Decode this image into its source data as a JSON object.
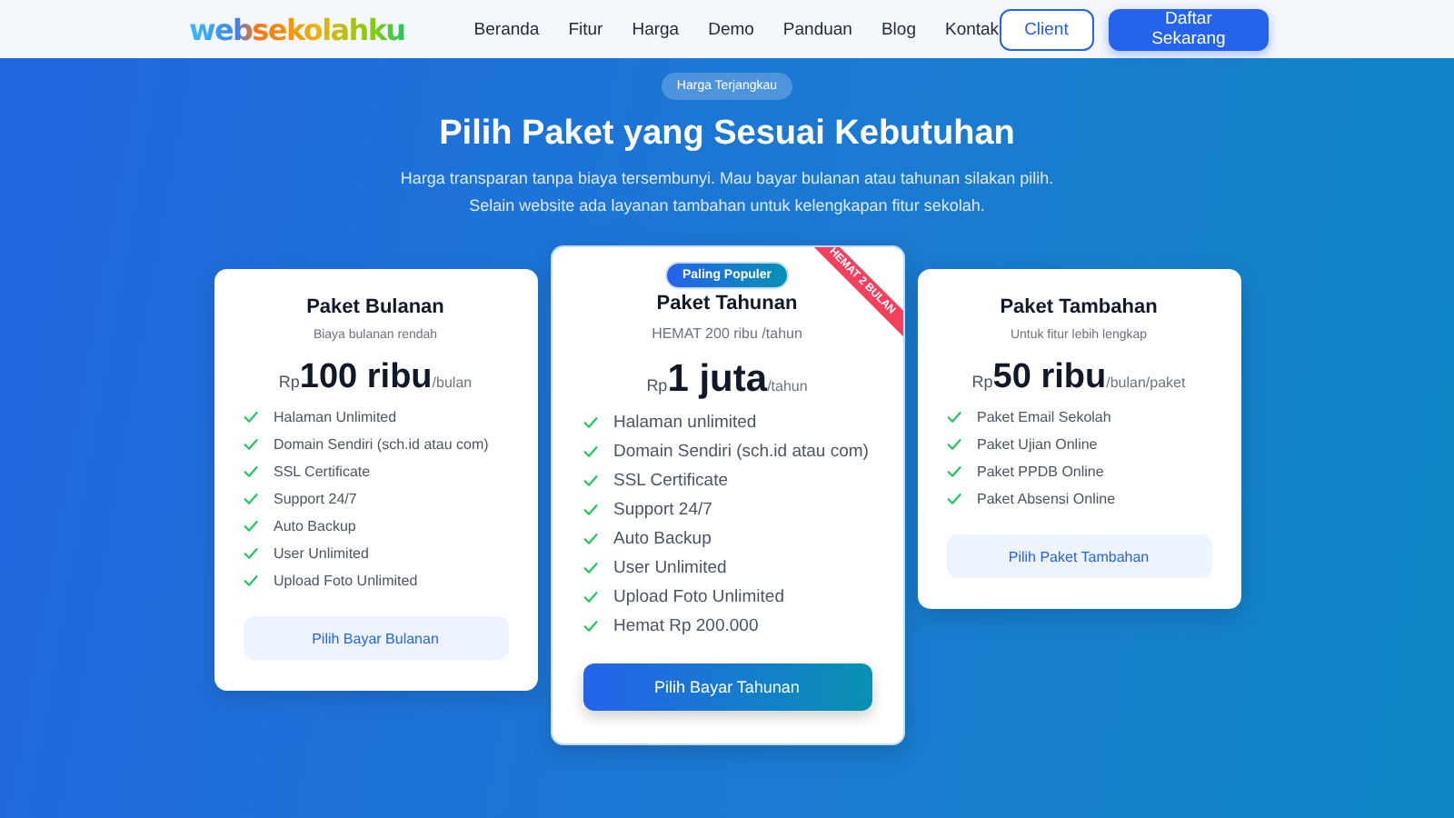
{
  "nav": {
    "logo": "websekolahku",
    "links": [
      "Beranda",
      "Fitur",
      "Harga",
      "Demo",
      "Panduan",
      "Blog",
      "Kontak"
    ],
    "buttons": [
      {
        "label": "Client",
        "kind": "outline"
      },
      {
        "label": "Daftar Sekarang",
        "kind": "solid"
      }
    ]
  },
  "hero": {
    "badge": "Harga Terjangkau",
    "title": "Pilih Paket yang Sesuai Kebutuhan",
    "lines": [
      "Harga transparan tanpa biaya tersembunyi. Mau bayar bulanan atau tahunan silakan pilih.",
      "Selain website ada layanan tambahan untuk kelengkapan fitur sekolah."
    ]
  },
  "plans": [
    {
      "featured": false,
      "name": "Paket Bulanan",
      "subtitle": "Biaya bulanan rendah",
      "currency": "Rp",
      "amount": "100 ribu",
      "period": "/bulan",
      "features": [
        "Halaman Unlimited",
        "Domain Sendiri (sch.id atau com)",
        "SSL Certificate",
        "Support 24/7",
        "Auto Backup",
        "User Unlimited",
        "Upload Foto Unlimited"
      ],
      "button": "Pilih Bayar Bulanan"
    },
    {
      "featured": true,
      "badge": "Paling Populer",
      "ribbon": "HEMAT 2 BULAN",
      "name": "Paket Tahunan",
      "subtitle": "HEMAT 200 ribu /tahun",
      "currency": "Rp",
      "amount": "1 juta",
      "period": "/tahun",
      "features": [
        "Halaman unlimited",
        "Domain Sendiri (sch.id atau com)",
        "SSL Certificate",
        "Support 24/7",
        "Auto Backup",
        "User Unlimited",
        "Upload Foto Unlimited",
        "Hemat Rp 200.000"
      ],
      "button": "Pilih Bayar Tahunan"
    },
    {
      "featured": false,
      "name": "Paket Tambahan",
      "subtitle": "Untuk fitur lebih lengkap",
      "currency": "Rp",
      "amount": "50 ribu",
      "period": "/bulan/paket",
      "features": [
        "Paket Email Sekolah",
        "Paket Ujian Online",
        "Paket PPDB Online",
        "Paket Absensi Online"
      ],
      "button": "Pilih Paket Tambahan"
    }
  ]
}
